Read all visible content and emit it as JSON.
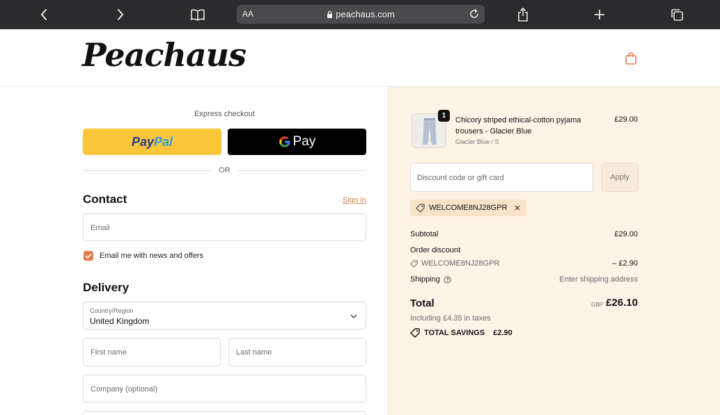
{
  "browser": {
    "text_size_label": "AA",
    "url": "peachaus.com"
  },
  "header": {
    "logo": "Peachaus"
  },
  "express": {
    "label": "Express checkout",
    "paypal_part1": "Pay",
    "paypal_part2": "Pal",
    "gpay_label": "Pay",
    "or_label": "OR"
  },
  "contact": {
    "title": "Contact",
    "sign_in": "Sign in",
    "email_placeholder": "Email",
    "newsletter_label": "Email me with news and offers",
    "newsletter_checked": true
  },
  "delivery": {
    "title": "Delivery",
    "country_label": "Country/Region",
    "country_value": "United Kingdom",
    "first_name_placeholder": "First name",
    "last_name_placeholder": "Last name",
    "company_placeholder": "Company (optional)"
  },
  "order": {
    "item": {
      "quantity": "1",
      "name": "Chicory striped ethical-cotton pyjama trousers - Glacier Blue",
      "variant": "Glacier Blue / S",
      "price": "£29.00"
    },
    "discount_placeholder": "Discount code or gift card",
    "apply_label": "Apply",
    "applied_code": "WELCOME8NJ28GPR",
    "subtotal_label": "Subtotal",
    "subtotal_value": "£29.00",
    "order_discount_label": "Order discount",
    "discount_code": "WELCOME8NJ28GPR",
    "discount_value": "– £2.90",
    "shipping_label": "Shipping",
    "shipping_value": "Enter shipping address",
    "total_label": "Total",
    "total_currency": "GBP",
    "total_value": "£26.10",
    "taxes_note": "Including £4.35 in taxes",
    "savings_label": "TOTAL SAVINGS",
    "savings_value": "£2.90"
  },
  "colors": {
    "accent": "#e07e4c",
    "sidebar_bg": "#fdf3e7",
    "paypal_yellow": "#fcc63b"
  }
}
